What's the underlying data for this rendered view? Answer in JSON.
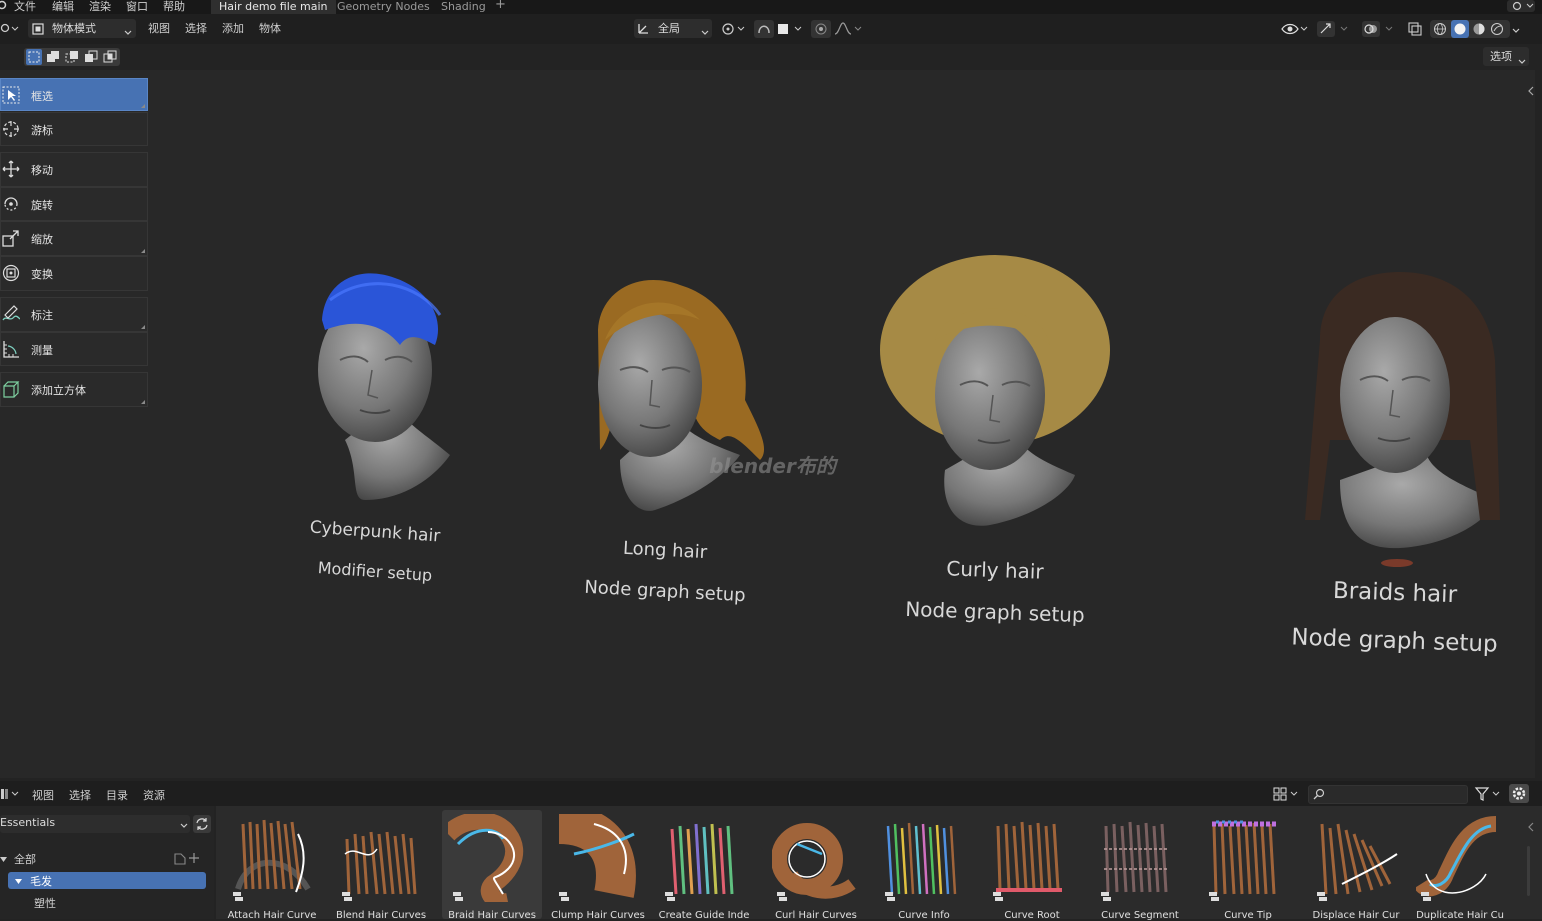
{
  "menu": {
    "items": [
      "文件",
      "编辑",
      "渲染",
      "窗口",
      "帮助"
    ],
    "workspaces": [
      {
        "label": "Hair demo file main",
        "active": true
      },
      {
        "label": "Geometry Nodes",
        "active": false
      },
      {
        "label": "Shading",
        "active": false
      }
    ],
    "add_tab": "+"
  },
  "header": {
    "mode": "物体模式",
    "menus": [
      "视图",
      "选择",
      "添加",
      "物体"
    ],
    "transform_orientation": "全局",
    "options": "选项"
  },
  "tools": [
    {
      "label": "框选",
      "icon": "select-box-icon",
      "active": true
    },
    {
      "label": "游标",
      "icon": "cursor-icon",
      "active": false
    },
    {
      "label": "移动",
      "icon": "move-icon",
      "active": false
    },
    {
      "label": "旋转",
      "icon": "rotate-icon",
      "active": false
    },
    {
      "label": "缩放",
      "icon": "scale-icon",
      "active": false
    },
    {
      "label": "变换",
      "icon": "transform-icon",
      "active": false
    },
    {
      "label": "标注",
      "icon": "annotate-icon",
      "active": false
    },
    {
      "label": "测量",
      "icon": "measure-icon",
      "active": false
    },
    {
      "label": "添加立方体",
      "icon": "add-cube-icon",
      "active": false
    }
  ],
  "scene": {
    "watermark": "blender布的",
    "heads": [
      {
        "title": "Cyberpunk hair",
        "subtitle": "Modifier setup",
        "hair_color": "#2a55d8"
      },
      {
        "title": "Long hair",
        "subtitle": "Node graph setup",
        "hair_color": "#9a6a22"
      },
      {
        "title": "Curly hair",
        "subtitle": "Node graph setup",
        "hair_color": "#a68a45"
      },
      {
        "title": "Braids hair",
        "subtitle": "Node graph setup",
        "hair_color": "#3a2a22"
      }
    ]
  },
  "asset_browser": {
    "menus": [
      "视图",
      "选择",
      "目录",
      "资源"
    ],
    "library": "Essentials",
    "tree": {
      "root": "全部",
      "selected": "毛发",
      "child": "塑性"
    },
    "assets": [
      {
        "label": "Attach Hair Curve",
        "selected": false
      },
      {
        "label": "Blend Hair Curves",
        "selected": false
      },
      {
        "label": "Braid Hair Curves",
        "selected": true
      },
      {
        "label": "Clump Hair Curves",
        "selected": false
      },
      {
        "label": "Create Guide Inde",
        "selected": false
      },
      {
        "label": "Curl Hair Curves",
        "selected": false
      },
      {
        "label": "Curve Info",
        "selected": false
      },
      {
        "label": "Curve Root",
        "selected": false
      },
      {
        "label": "Curve Segment",
        "selected": false
      },
      {
        "label": "Curve Tip",
        "selected": false
      },
      {
        "label": "Displace Hair Cur",
        "selected": false
      },
      {
        "label": "Duplicate Hair Cu",
        "selected": false
      }
    ]
  },
  "colors": {
    "accent": "#4772b3",
    "viewport_bg": "#282828",
    "hair_brown": "#a0643a"
  }
}
